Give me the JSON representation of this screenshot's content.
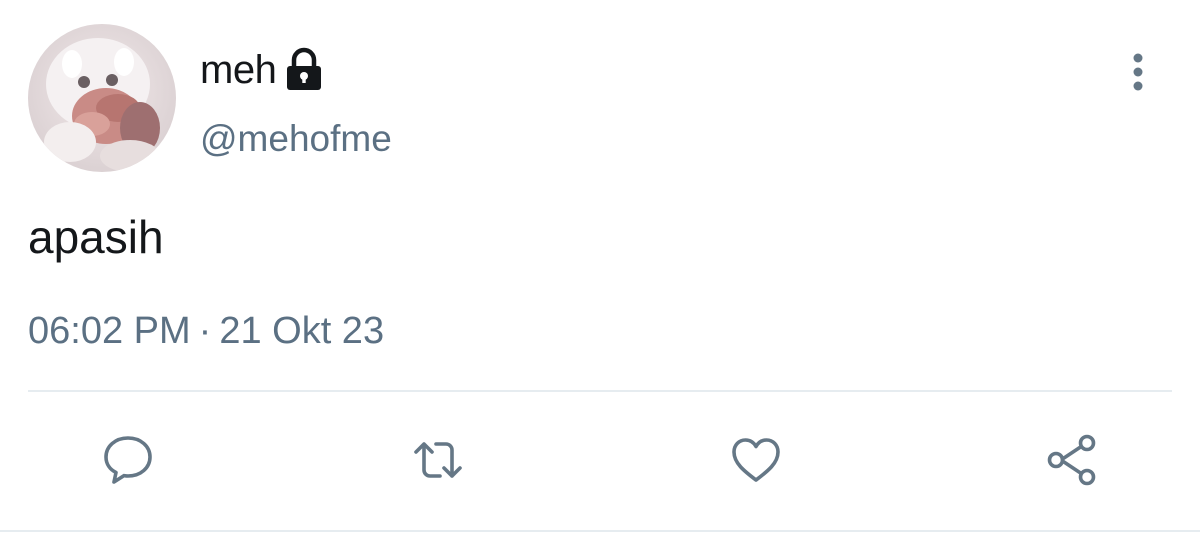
{
  "user": {
    "display_name": "meh",
    "handle": "@mehofme",
    "protected": true
  },
  "tweet": {
    "text": "apasih",
    "time": "06:02 PM",
    "separator": "·",
    "date": "21 Okt 23"
  },
  "actions": [
    {
      "name": "reply",
      "icon": "speech-bubble-icon"
    },
    {
      "name": "retweet",
      "icon": "retweet-arrows-icon"
    },
    {
      "name": "like",
      "icon": "heart-icon"
    },
    {
      "name": "share",
      "icon": "share-nodes-icon"
    }
  ],
  "colors": {
    "text_primary": "#14171a",
    "text_secondary": "#5b7083",
    "icon": "#657786",
    "divider": "#e6ecf0"
  }
}
